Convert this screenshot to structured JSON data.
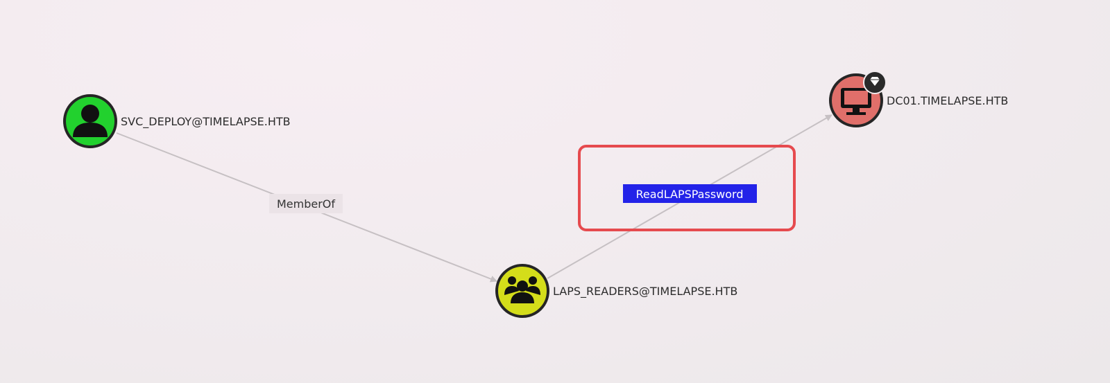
{
  "nodes": {
    "user": {
      "label": "SVC_DEPLOY@TIMELAPSE.HTB",
      "type": "User",
      "icon": "user-icon",
      "color": "#22d12e"
    },
    "group": {
      "label": "LAPS_READERS@TIMELAPSE.HTB",
      "type": "Group",
      "icon": "group-icon",
      "color": "#d4dd1a"
    },
    "computer": {
      "label": "DC01.TIMELAPSE.HTB",
      "type": "Computer",
      "icon": "computer-icon",
      "color": "#e06f6a",
      "badge_icon": "diamond-icon"
    }
  },
  "edges": {
    "member_of": {
      "label": "MemberOf",
      "from": "user",
      "to": "group"
    },
    "read_laps": {
      "label": "ReadLAPSPassword",
      "from": "group",
      "to": "computer",
      "selected": true
    }
  },
  "colors": {
    "edge": "#c6c0c3",
    "highlight_box": "#e64a4e",
    "selected_label_bg": "#2323e8",
    "node_border": "#252525"
  }
}
